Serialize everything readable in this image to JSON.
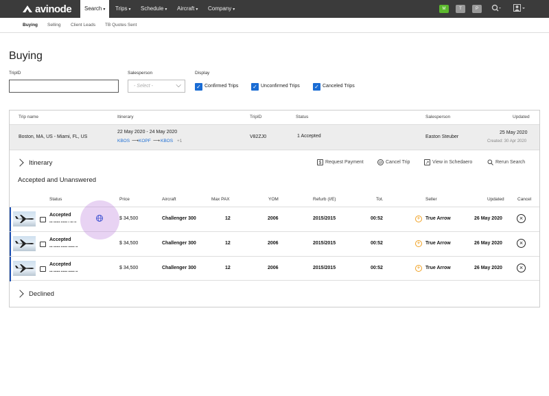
{
  "nav": {
    "logo": "avinode",
    "items": [
      "Search",
      "Trips",
      "Schedule",
      "Aircraft",
      "Company"
    ],
    "badges": [
      "M",
      "T",
      "P"
    ],
    "accent": "#5cb82e"
  },
  "subnav": [
    "Buying",
    "Selling",
    "Client Leads",
    "TB Quotes Sent"
  ],
  "title": "Buying",
  "filters": {
    "tripid_label": "TripID",
    "salesperson_label": "Salesperson",
    "salesperson_placeholder": "- Select -",
    "display_label": "Display",
    "display_options": [
      "Confirmed Trips",
      "Unconfirmed Trips",
      "Canceled Trips"
    ]
  },
  "trip_table": {
    "headers": [
      "Trip name",
      "Itinerary",
      "TripID",
      "Status",
      "Salesperson",
      "Updated"
    ],
    "row": {
      "name": "Boston, MA, US - Miami, FL, US",
      "dates": "22 May 2020 - 24 May 2020",
      "route": [
        "KBOS",
        "KOPF",
        "KBOS"
      ],
      "route_extra": "+1",
      "tripid": "V82ZJ0",
      "status": "1 Accepted",
      "salesperson": "Easton Steuber",
      "updated": "25 May 2020",
      "created": "Created: 30 Apr 2020"
    }
  },
  "itinerary_label": "Itinerary",
  "actions": [
    "Request Payment",
    "Cancel Trip",
    "View in Schedaero",
    "Rerun Search"
  ],
  "section_accepted": "Accepted and Unanswered",
  "quotes": {
    "headers": [
      "Status",
      "Price",
      "Aircraft",
      "Max PAX",
      "YOM",
      "Refurb (I/E)",
      "Tot.",
      "Seller",
      "Updated",
      "Cancel"
    ],
    "rows": [
      {
        "status": "Accepted",
        "sub": "••• •••••• •••••• • ••• ••",
        "price": "$ 34,500",
        "aircraft": "Challenger 300",
        "pax": "12",
        "yom": "2006",
        "refurb": "2015/2015",
        "tot": "00:52",
        "seller": "True Arrow",
        "updated": "26 May 2020"
      },
      {
        "status": "Accepted",
        "sub": "••• •••••• •••••• •••••• ••",
        "price": "$ 34,500",
        "aircraft": "Challenger 300",
        "pax": "12",
        "yom": "2006",
        "refurb": "2015/2015",
        "tot": "00:52",
        "seller": "True Arrow",
        "updated": "26 May 2020"
      },
      {
        "status": "Accepted",
        "sub": "••• •••••• •••••• •••••• ••",
        "price": "$ 34,500",
        "aircraft": "Challenger 300",
        "pax": "12",
        "yom": "2006",
        "refurb": "2015/2015",
        "tot": "00:52",
        "seller": "True Arrow",
        "updated": "26 May 2020"
      }
    ]
  },
  "section_declined": "Declined"
}
